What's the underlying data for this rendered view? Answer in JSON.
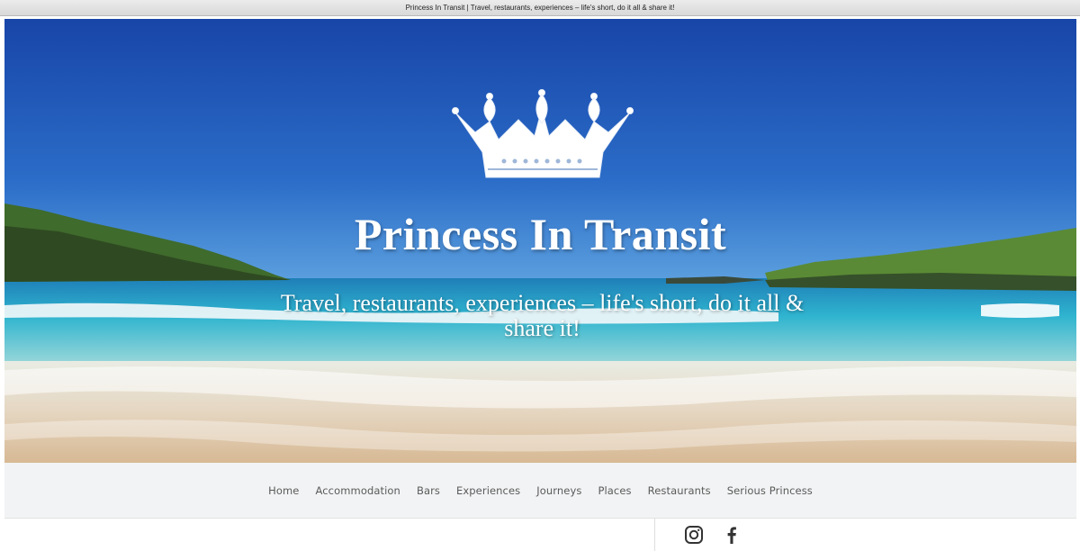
{
  "window": {
    "title": "Princess In Transit | Travel, restaurants, experiences – life's short, do it all & share it!"
  },
  "hero": {
    "logo_icon": "crown-icon",
    "title": "Princess In Transit",
    "tagline": "Travel, restaurants, experiences – life's short, do it all & share it!"
  },
  "nav": {
    "items": [
      {
        "label": "Home"
      },
      {
        "label": "Accommodation"
      },
      {
        "label": "Bars"
      },
      {
        "label": "Experiences"
      },
      {
        "label": "Journeys"
      },
      {
        "label": "Places"
      },
      {
        "label": "Restaurants"
      },
      {
        "label": "Serious Princess"
      }
    ]
  },
  "social": {
    "icons": [
      "instagram-icon",
      "facebook-icon"
    ]
  },
  "colors": {
    "nav_background": "#f2f3f4",
    "nav_text": "#5a5a5a",
    "sky": "#1d4fae",
    "sea": "#27a8c6"
  }
}
